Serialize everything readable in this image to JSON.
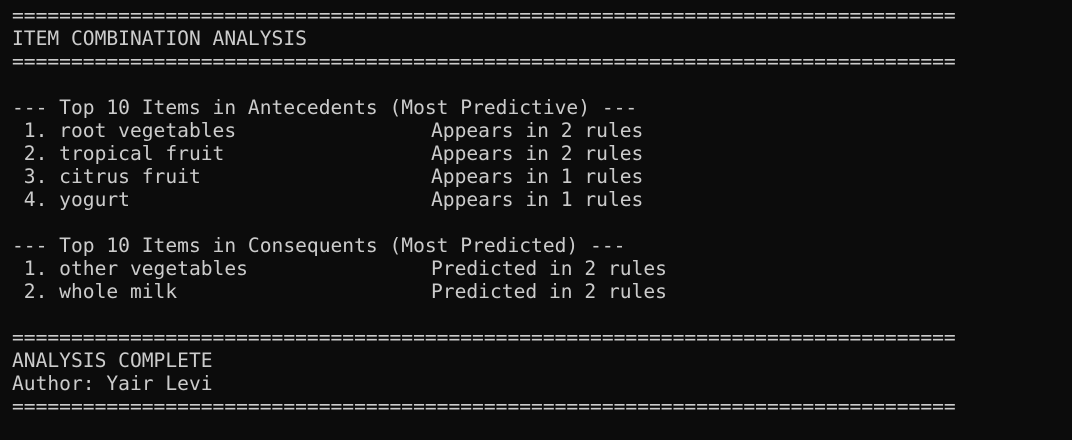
{
  "separator": "================================================================================",
  "header_title": "ITEM COMBINATION ANALYSIS",
  "antecedents": {
    "heading": "--- Top 10 Items in Antecedents (Most Predictive) ---",
    "items": [
      {
        "label": " 1. root vegetables",
        "info": "Appears in 2 rules"
      },
      {
        "label": " 2. tropical fruit",
        "info": "Appears in 2 rules"
      },
      {
        "label": " 3. citrus fruit",
        "info": "Appears in 1 rules"
      },
      {
        "label": " 4. yogurt",
        "info": "Appears in 1 rules"
      }
    ]
  },
  "consequents": {
    "heading": "--- Top 10 Items in Consequents (Most Predicted) ---",
    "items": [
      {
        "label": " 1. other vegetables",
        "info": "Predicted in 2 rules"
      },
      {
        "label": " 2. whole milk",
        "info": "Predicted in 2 rules"
      }
    ]
  },
  "footer": {
    "status": "ANALYSIS COMPLETE",
    "author": "Author: Yair Levi"
  },
  "colors": {
    "background": "#0c0c0c",
    "text": "#cccccc"
  }
}
